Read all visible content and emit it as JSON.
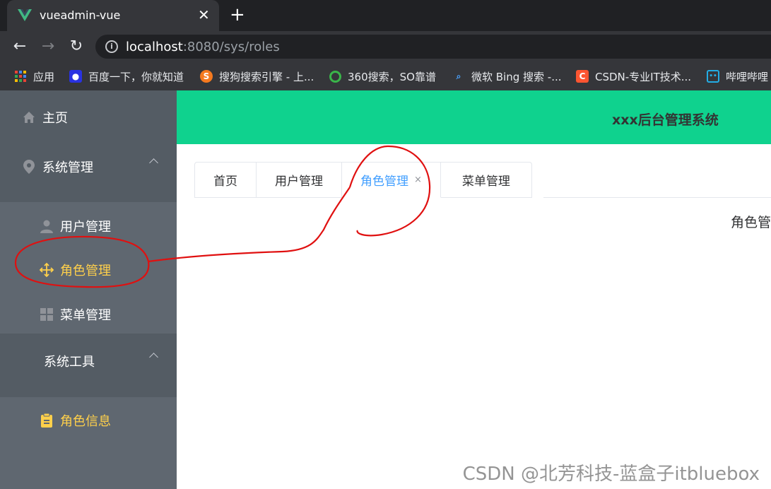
{
  "browser": {
    "tab_title": "vueadmin-vue",
    "url_host": "localhost",
    "url_path": ":8080/sys/roles",
    "bookmarks": [
      {
        "label": "应用",
        "icon": "apps-grid-icon"
      },
      {
        "label": "百度一下，你就知道",
        "icon": "baidu-paw-icon"
      },
      {
        "label": "搜狗搜索引擎 - 上...",
        "icon": "sogou-icon"
      },
      {
        "label": "360搜索，SO靠谱",
        "icon": "360-search-icon"
      },
      {
        "label": "微软 Bing 搜索 -...",
        "icon": "bing-search-icon"
      },
      {
        "label": "CSDN-专业IT技术...",
        "icon": "csdn-icon"
      },
      {
        "label": "哔哩哔哩",
        "icon": "bilibili-tv-icon"
      }
    ]
  },
  "app": {
    "header_title": "xxx后台管理系统",
    "sidebar": {
      "home": "主页",
      "system_management": "系统管理",
      "user_management": "用户管理",
      "role_management": "角色管理",
      "menu_management": "菜单管理",
      "system_tools": "系统工具",
      "role_info": "角色信息"
    },
    "tabs": [
      {
        "label": "首页"
      },
      {
        "label": "用户管理"
      },
      {
        "label": "角色管理",
        "close": "×"
      },
      {
        "label": "菜单管理"
      }
    ],
    "content_text": "角色管"
  },
  "watermark": "CSDN @北芳科技-蓝盒子itbluebox",
  "colors": {
    "sidebar_bg": "#545c64",
    "active_menu": "#ffd04b",
    "header_bg": "#0fd28e",
    "active_tab": "#409eff",
    "annotation": "#e01010"
  }
}
